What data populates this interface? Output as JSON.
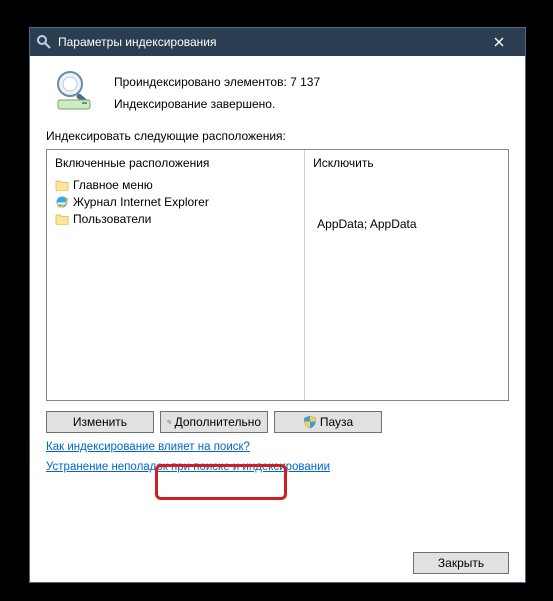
{
  "window": {
    "title": "Параметры индексирования"
  },
  "status": {
    "indexed": "Проиндексировано элементов: 7 137",
    "state": "Индексирование завершено."
  },
  "section_label": "Индексировать следующие расположения:",
  "columns": {
    "included": "Включенные расположения",
    "excluded": "Исключить"
  },
  "locations": [
    {
      "icon": "folder",
      "label": "Главное меню",
      "exclude": ""
    },
    {
      "icon": "ie",
      "label": "Журнал Internet Explorer",
      "exclude": ""
    },
    {
      "icon": "folder",
      "label": "Пользователи",
      "exclude": "AppData; AppData"
    }
  ],
  "buttons": {
    "modify": "Изменить",
    "advanced": "Дополнительно",
    "pause": "Пауза",
    "close": "Закрыть"
  },
  "links": {
    "how": "Как индексирование влияет на поиск?",
    "troubleshoot": "Устранение неполадок при поиске и индексировании"
  }
}
